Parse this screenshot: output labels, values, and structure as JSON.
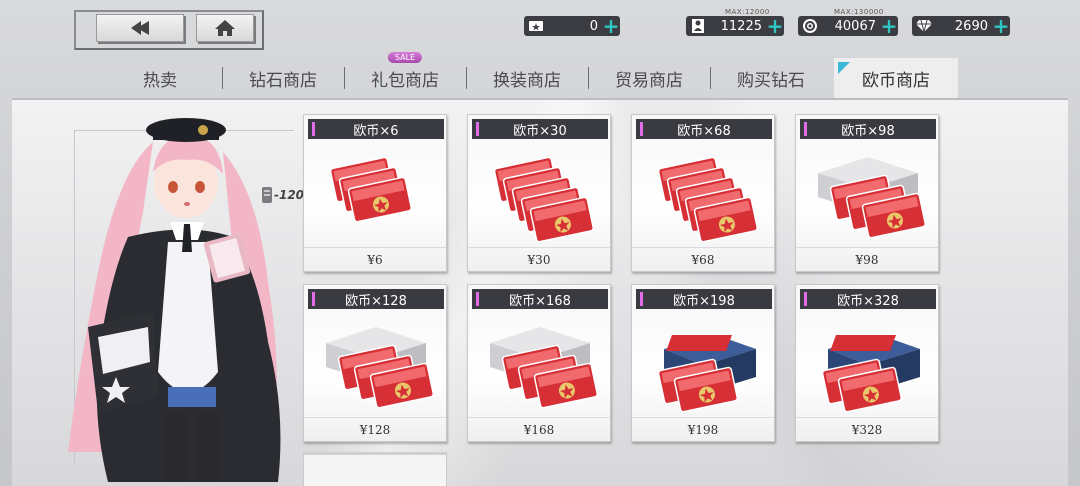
{
  "nav": {
    "back_icon": "back-arrow-icon",
    "home_icon": "home-icon"
  },
  "resources": [
    {
      "icon": "ticket-icon",
      "value": "0",
      "max": ""
    },
    {
      "icon": "manpower-icon",
      "value": "11225",
      "max": "MAX:12000"
    },
    {
      "icon": "gear-coin-icon",
      "value": "40067",
      "max": "MAX:130000"
    },
    {
      "icon": "diamond-icon",
      "value": "2690",
      "max": ""
    }
  ],
  "tabs": [
    {
      "label": "热卖",
      "sale": ""
    },
    {
      "label": "钻石商店",
      "sale": ""
    },
    {
      "label": "礼包商店",
      "sale": "SALE"
    },
    {
      "label": "换装商店",
      "sale": ""
    },
    {
      "label": "贸易商店",
      "sale": ""
    },
    {
      "label": "购买钻石",
      "sale": ""
    },
    {
      "label": "欧币商店",
      "sale": ""
    }
  ],
  "active_tab": "欧币商店",
  "cost_tag": "-120",
  "products": [
    {
      "title": "欧币×6",
      "price": "¥6",
      "package": "small"
    },
    {
      "title": "欧币×30",
      "price": "¥30",
      "package": "small"
    },
    {
      "title": "欧币×68",
      "price": "¥68",
      "package": "small"
    },
    {
      "title": "欧币×98",
      "price": "¥98",
      "package": "box"
    },
    {
      "title": "欧币×128",
      "price": "¥128",
      "package": "box"
    },
    {
      "title": "欧币×168",
      "price": "¥168",
      "package": "box"
    },
    {
      "title": "欧币×198",
      "price": "¥198",
      "package": "crate"
    },
    {
      "title": "欧币×328",
      "price": "¥328",
      "package": "crate"
    }
  ],
  "colors": {
    "accent": "#2fc7c1",
    "title_bg": "#3a3b40",
    "title_mark": "#e06ee8",
    "tab_corner": "#3db8d8"
  }
}
